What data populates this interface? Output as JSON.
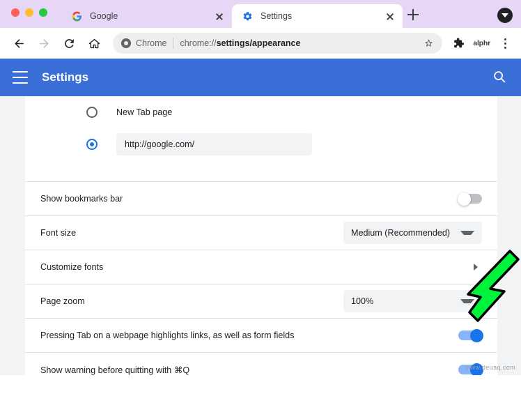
{
  "browser": {
    "tabs": [
      {
        "title": "Google",
        "favicon": "google-icon",
        "active": false,
        "close_label": "close-tab"
      },
      {
        "title": "Settings",
        "favicon": "gear-icon",
        "active": true,
        "close_label": "close-tab"
      }
    ],
    "new_tab_label": "+",
    "tab_search_icon": "tab-search-icon",
    "toolbar": {
      "back_icon": "back-arrow-icon",
      "forward_icon": "forward-arrow-icon",
      "reload_icon": "reload-icon",
      "home_icon": "home-icon",
      "omnibox": {
        "scheme_label": "Chrome",
        "url_prefix": "chrome://",
        "url_bold": "settings/appearance",
        "full_url": "chrome://settings/appearance"
      },
      "bookmark_icon": "star-icon",
      "extensions_icon": "puzzle-piece-icon",
      "profile_label": "alphr",
      "menu_icon": "three-dot-menu-icon"
    }
  },
  "settings_header": {
    "menu_icon": "hamburger-menu-icon",
    "title": "Settings",
    "search_icon": "search-icon"
  },
  "startup_section": {
    "options": [
      {
        "label": "New Tab page",
        "selected": false
      },
      {
        "label": "http://google.com/",
        "selected": true,
        "is_field": true
      }
    ]
  },
  "appearance_rows": [
    {
      "label": "Show bookmarks bar",
      "control": "toggle",
      "state": "off"
    },
    {
      "label": "Font size",
      "control": "select",
      "value": "Medium (Recommended)"
    },
    {
      "label": "Customize fonts",
      "control": "chevron"
    },
    {
      "label": "Page zoom",
      "control": "select",
      "value": "100%"
    },
    {
      "label": "Pressing Tab on a webpage highlights links, as well as form fields",
      "control": "toggle",
      "state": "on"
    },
    {
      "label": "Show warning before quitting with ⌘Q",
      "control": "toggle",
      "state": "on"
    }
  ],
  "annotation": {
    "shape": "green-arrow",
    "points_at": "Font size",
    "fill_color": "#00F33B",
    "stroke_color": "#000000"
  },
  "watermark": {
    "text": "www.deuaq.com"
  },
  "colors": {
    "tabstrip_bg": "#E8D6F7",
    "settings_header_bg": "#3A6FD8",
    "accent_blue": "#1A73E8",
    "toggle_on_track": "#8AB4F8",
    "page_bg": "#F1F3F4"
  }
}
